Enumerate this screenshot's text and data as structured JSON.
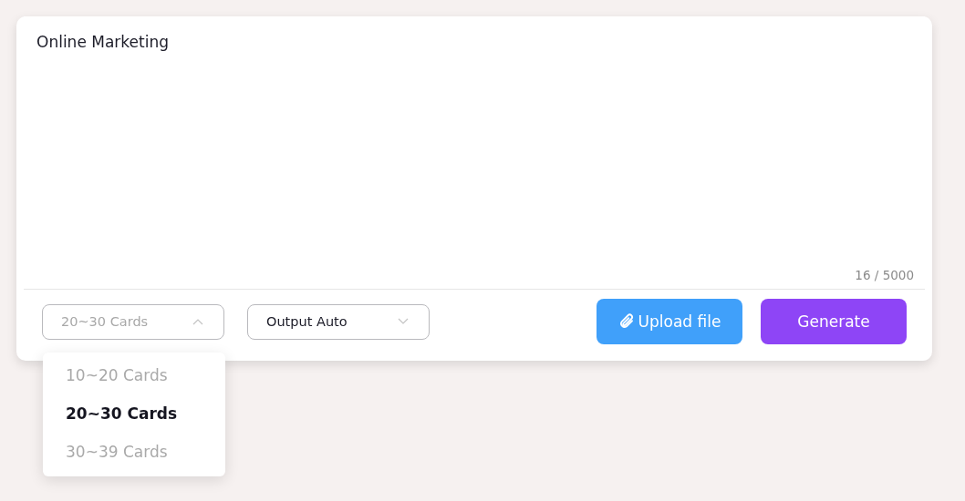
{
  "prompt": {
    "value": "Online Marketing",
    "counter": "16 / 5000"
  },
  "selects": [
    {
      "value": "20~30 Cards",
      "expanded": true
    },
    {
      "value": "Output Auto",
      "expanded": false
    }
  ],
  "menu": [
    {
      "label": "10~20 Cards",
      "selected": false
    },
    {
      "label": "20~30 Cards",
      "selected": true
    },
    {
      "label": "30~39 Cards",
      "selected": false
    }
  ],
  "buttons": [
    {
      "kind": "upload",
      "label": "Upload file"
    },
    {
      "kind": "generate",
      "label": "Generate"
    }
  ]
}
